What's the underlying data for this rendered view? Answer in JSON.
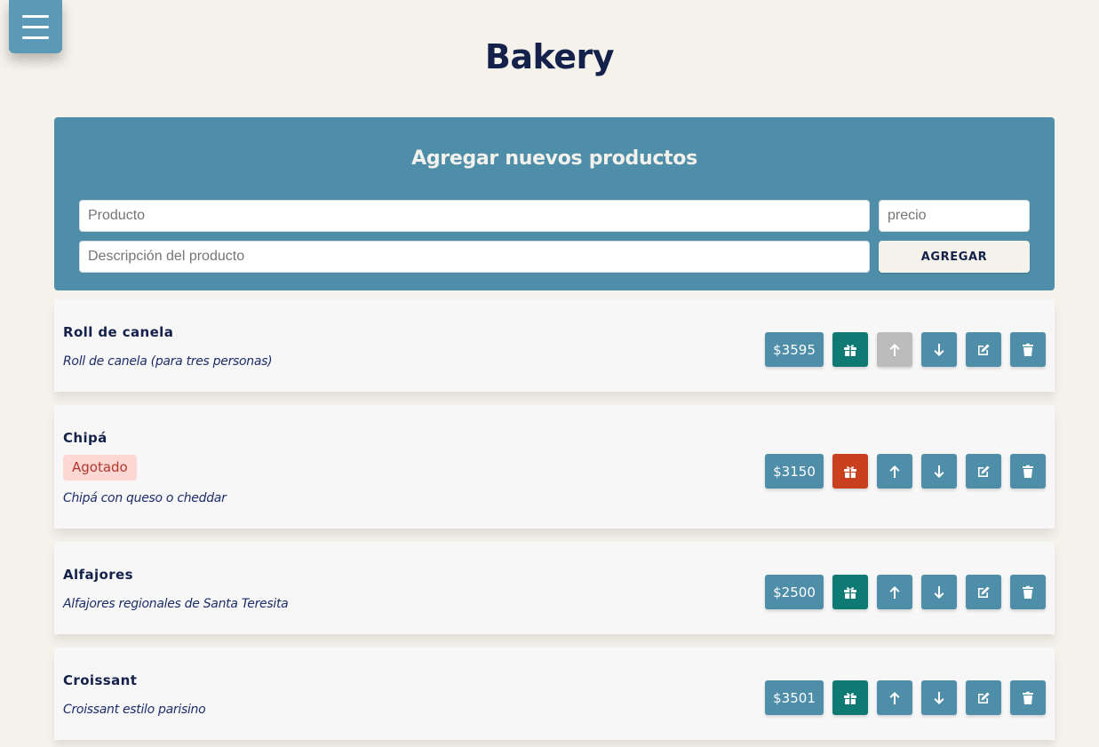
{
  "header": {
    "title": "Bakery"
  },
  "add_form": {
    "title": "Agregar nuevos productos",
    "product_placeholder": "Producto",
    "product_value": "",
    "price_placeholder": "precio",
    "price_value": "",
    "description_placeholder": "Descripción del producto",
    "description_value": "",
    "submit_label": "AGREGAR"
  },
  "products": [
    {
      "name": "Roll de canela",
      "description": "Roll de canela (para tres personas)",
      "price": "$3595",
      "status": "",
      "in_stock": true,
      "move_up_enabled": false
    },
    {
      "name": "Chipá",
      "description": "Chipá con queso o cheddar",
      "price": "$3150",
      "status": "Agotado",
      "in_stock": false,
      "move_up_enabled": true
    },
    {
      "name": "Alfajores",
      "description": "Alfajores regionales de Santa Teresita",
      "price": "$2500",
      "status": "",
      "in_stock": true,
      "move_up_enabled": true
    },
    {
      "name": "Croissant",
      "description": "Croissant estilo parisino",
      "price": "$3501",
      "status": "",
      "in_stock": true,
      "move_up_enabled": true
    }
  ],
  "colors": {
    "background": "#f5f2eb",
    "primary": "#4e8ea8",
    "in_stock": "#0f7a73",
    "out_of_stock": "#c9401f",
    "disabled": "#bcbcbc",
    "text": "#14214a",
    "badge_bg": "#fcd7d4",
    "badge_text": "#b3372b"
  },
  "icons": {
    "menu": "hamburger-icon",
    "stock": "gift-icon",
    "move_up": "arrow-up-icon",
    "move_down": "arrow-down-icon",
    "edit": "pencil-square-icon",
    "delete": "trash-icon"
  }
}
